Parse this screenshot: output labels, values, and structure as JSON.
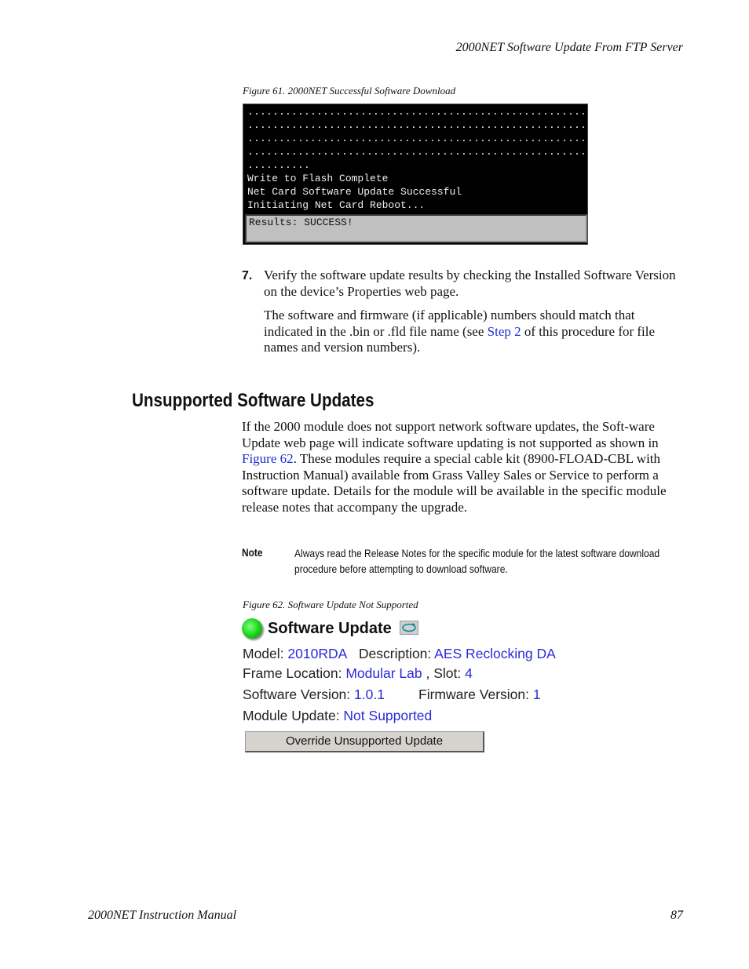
{
  "header": {
    "running_title": "2000NET Software Update From FTP Server"
  },
  "figure61": {
    "caption": "Figure 61.  2000NET Successful Software Download",
    "terminal_lines": [
      "......................................................",
      "......................................................",
      "......................................................",
      "......................................................",
      "..........",
      "Write to Flash Complete",
      "Net Card Software Update Successful",
      "Initiating Net Card Reboot..."
    ],
    "result": "Results: SUCCESS!"
  },
  "step7": {
    "number": "7.",
    "text": "Verify the software update results by checking the Installed Software Version on the device’s Properties web page.",
    "para_before": "The software and firmware (if applicable) numbers should match that indicated in the .bin or .fld file name (see ",
    "link": "Step 2",
    "para_after": " of this procedure for file names and version numbers)."
  },
  "section": {
    "title": "Unsupported Software Updates",
    "body_before": "If the 2000 module does not support network software updates, the Soft-ware Update web page will indicate software updating is not supported as shown in ",
    "link": "Figure 62",
    "body_after": ". These modules require a special cable kit (8900-FLOAD-CBL with Instruction Manual) available from Grass Valley Sales or Service to perform a software update. Details for the module will be available in the specific module release notes that accompany the upgrade."
  },
  "note": {
    "label": "Note",
    "text": "Always read the Release Notes for the specific module for the latest software download procedure before attempting to download software."
  },
  "figure62": {
    "caption": "Figure 62.  Software Update Not Supported",
    "title": "Software Update",
    "model_label": "Model: ",
    "model": "2010RDA",
    "description_label": "Description: ",
    "description": "AES Reclocking DA",
    "frame_label": "Frame Location: ",
    "frame": "Modular Lab",
    "slot_label": " , Slot: ",
    "slot": "4",
    "sw_label": "Software Version: ",
    "sw": "1.0.1",
    "fw_label": "Firmware Version: ",
    "fw": "1",
    "update_label": "Module Update: ",
    "update": "Not Supported",
    "button": "Override Unsupported Update"
  },
  "footer": {
    "manual": "2000NET Instruction Manual",
    "page": "87"
  }
}
